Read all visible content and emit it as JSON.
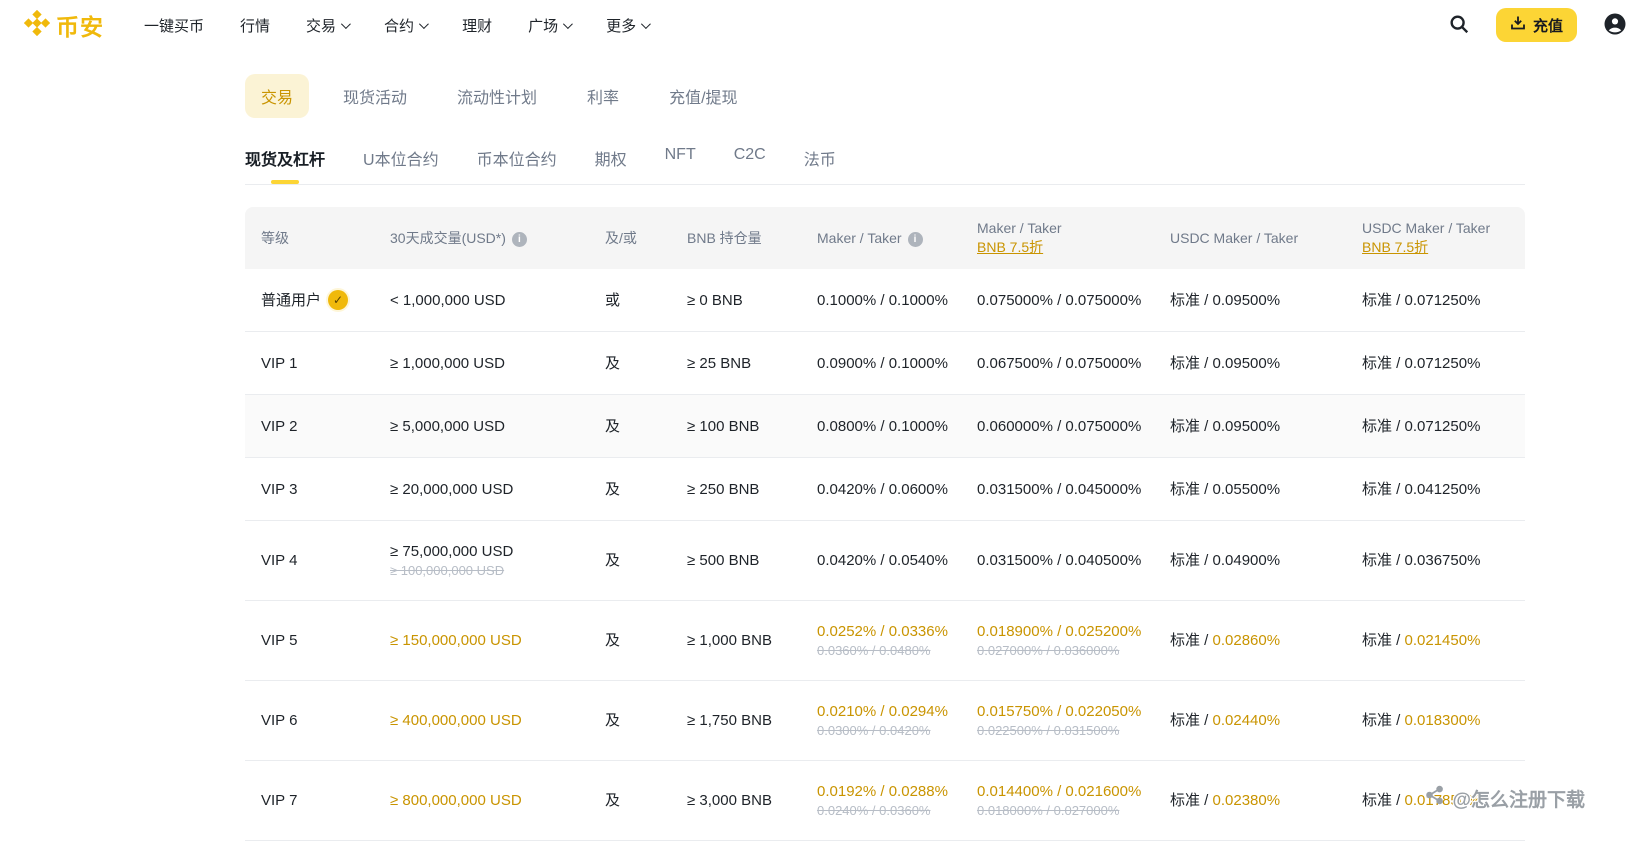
{
  "brand": {
    "name": "币安"
  },
  "nav": {
    "items": [
      {
        "label": "一键买币",
        "caret": false
      },
      {
        "label": "行情",
        "caret": false
      },
      {
        "label": "交易",
        "caret": true
      },
      {
        "label": "合约",
        "caret": true
      },
      {
        "label": "理财",
        "caret": false
      },
      {
        "label": "广场",
        "caret": true
      },
      {
        "label": "更多",
        "caret": true
      }
    ],
    "deposit_label": "充值"
  },
  "tabs": [
    {
      "label": "交易",
      "active": true
    },
    {
      "label": "现货活动",
      "active": false
    },
    {
      "label": "流动性计划",
      "active": false
    },
    {
      "label": "利率",
      "active": false
    },
    {
      "label": "充值/提现",
      "active": false
    }
  ],
  "subtabs": [
    {
      "label": "现货及杠杆",
      "active": true
    },
    {
      "label": "U本位合约",
      "active": false
    },
    {
      "label": "币本位合约",
      "active": false
    },
    {
      "label": "期权",
      "active": false
    },
    {
      "label": "NFT",
      "active": false
    },
    {
      "label": "C2C",
      "active": false
    },
    {
      "label": "法币",
      "active": false
    }
  ],
  "table": {
    "std_label": "标准 / ",
    "headers": {
      "level": "等级",
      "volume": "30天成交量(USD*)",
      "logic": "及/或",
      "bnb": "BNB 持仓量",
      "maker_taker": "Maker / Taker",
      "maker_taker_bnb": "Maker / Taker",
      "maker_taker_bnb_link": "BNB 7.5折",
      "usdc": "USDC Maker / Taker",
      "usdc_bnb": "USDC Maker / Taker",
      "usdc_bnb_link": "BNB 7.5折"
    },
    "rows": [
      {
        "level": "普通用户",
        "badge": true,
        "volume": "< 1,000,000 USD",
        "logic": "或",
        "bnb": "≥ 0 BNB",
        "maker_taker": "0.1000% / 0.1000%",
        "bnb_discount": "0.075000% / 0.075000%",
        "usdc_taker": "0.09500%",
        "usdc_bnb_taker": "0.071250%"
      },
      {
        "level": "VIP 1",
        "volume": "≥ 1,000,000 USD",
        "logic": "及",
        "bnb": "≥ 25 BNB",
        "maker_taker": "0.0900% / 0.1000%",
        "bnb_discount": "0.067500% / 0.075000%",
        "usdc_taker": "0.09500%",
        "usdc_bnb_taker": "0.071250%"
      },
      {
        "level": "VIP 2",
        "shaded": true,
        "volume": "≥ 5,000,000 USD",
        "logic": "及",
        "bnb": "≥ 100 BNB",
        "maker_taker": "0.0800% / 0.1000%",
        "bnb_discount": "0.060000% / 0.075000%",
        "usdc_taker": "0.09500%",
        "usdc_bnb_taker": "0.071250%"
      },
      {
        "level": "VIP 3",
        "volume": "≥ 20,000,000 USD",
        "logic": "及",
        "bnb": "≥ 250 BNB",
        "maker_taker": "0.0420% / 0.0600%",
        "bnb_discount": "0.031500% / 0.045000%",
        "usdc_taker": "0.05500%",
        "usdc_bnb_taker": "0.041250%"
      },
      {
        "level": "VIP 4",
        "tall": true,
        "volume": "≥ 75,000,000 USD",
        "volume_old": "≥ 100,000,000 USD",
        "logic": "及",
        "bnb": "≥ 500 BNB",
        "maker_taker": "0.0420% / 0.0540%",
        "bnb_discount": "0.031500% / 0.040500%",
        "usdc_taker": "0.04900%",
        "usdc_bnb_taker": "0.036750%"
      },
      {
        "level": "VIP 5",
        "tall": true,
        "promo": true,
        "volume": "≥ 150,000,000 USD",
        "logic": "及",
        "bnb": "≥ 1,000 BNB",
        "maker_taker": "0.0252% / 0.0336%",
        "maker_taker_old": "0.0360% / 0.0480%",
        "bnb_discount": "0.018900% / 0.025200%",
        "bnb_discount_old": "0.027000% / 0.036000%",
        "usdc_taker": "0.02860%",
        "usdc_bnb_taker": "0.021450%"
      },
      {
        "level": "VIP 6",
        "tall": true,
        "promo": true,
        "volume": "≥ 400,000,000 USD",
        "logic": "及",
        "bnb": "≥ 1,750 BNB",
        "maker_taker": "0.0210% / 0.0294%",
        "maker_taker_old": "0.0300% / 0.0420%",
        "bnb_discount": "0.015750% / 0.022050%",
        "bnb_discount_old": "0.022500% / 0.031500%",
        "usdc_taker": "0.02440%",
        "usdc_bnb_taker": "0.018300%"
      },
      {
        "level": "VIP 7",
        "tall": true,
        "promo": true,
        "volume": "≥ 800,000,000 USD",
        "logic": "及",
        "bnb": "≥ 3,000 BNB",
        "maker_taker": "0.0192% / 0.0288%",
        "maker_taker_old": "0.0240% / 0.0360%",
        "bnb_discount": "0.014400% / 0.021600%",
        "bnb_discount_old": "0.018000% / 0.027000%",
        "usdc_taker": "0.02380%",
        "usdc_bnb_taker": "0.017850%"
      }
    ]
  },
  "watermark": {
    "text": "@怎么注册下载"
  },
  "colors": {
    "brand_yellow": "#FCD535",
    "logo_yellow": "#F0B90B",
    "gold_text": "#C99400",
    "dark_text": "#1E2329",
    "gray_text": "#707A8A",
    "strike_text": "#B7BDC6",
    "header_bg": "#F5F5F5",
    "row_border": "#EAECEF",
    "active_tab_bg": "#FBF3D5"
  }
}
